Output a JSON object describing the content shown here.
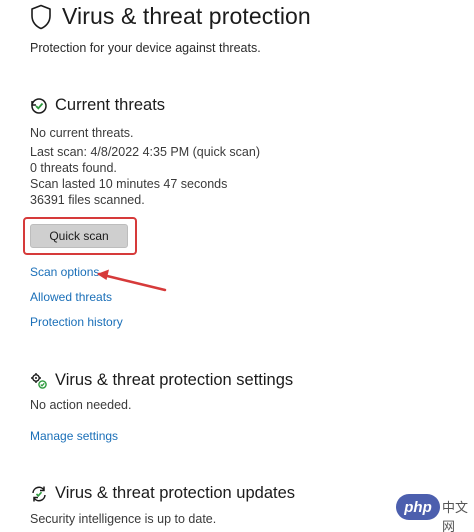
{
  "header": {
    "title": "Virus & threat protection",
    "subtitle": "Protection for your device against threats."
  },
  "current_threats": {
    "title": "Current threats",
    "lines": [
      "No current threats.",
      "Last scan: 4/8/2022 4:35 PM (quick scan)",
      "0 threats found.",
      "Scan lasted 10 minutes 47 seconds",
      "36391 files scanned."
    ],
    "quick_scan_label": "Quick scan",
    "links": [
      "Scan options",
      "Allowed threats",
      "Protection history"
    ]
  },
  "protection_settings": {
    "title": "Virus & threat protection settings",
    "status": "No action needed.",
    "link": "Manage settings"
  },
  "protection_updates": {
    "title": "Virus & threat protection updates",
    "status": "Security intelligence is up to date."
  },
  "watermark": {
    "brand": "php",
    "suffix": "中文网"
  },
  "colors": {
    "link": "#1a6fb8",
    "annotation": "#d63a3a",
    "button": "#cfcfcf"
  }
}
